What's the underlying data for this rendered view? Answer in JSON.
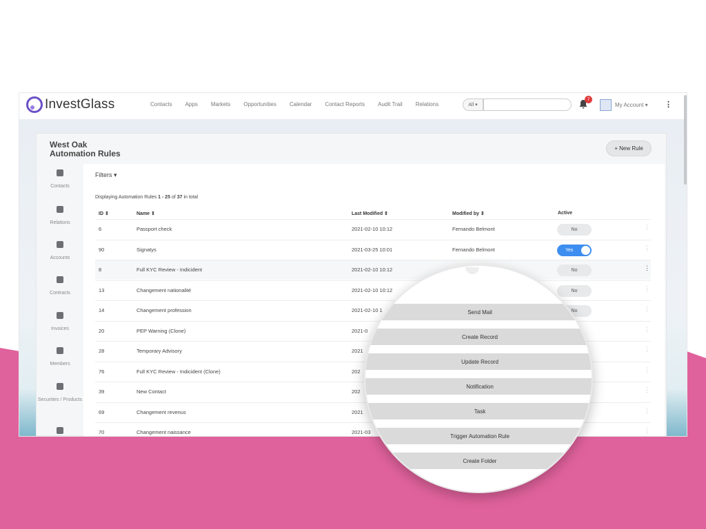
{
  "brand": {
    "name": "InvestGlass"
  },
  "nav": [
    "Contacts",
    "Apps",
    "Markets",
    "Opportunities",
    "Calendar",
    "Contact Reports",
    "Audit Trail",
    "Relations"
  ],
  "search": {
    "scope": "All ▾",
    "placeholder": ""
  },
  "notifications": {
    "count": "7"
  },
  "account": {
    "label": "My Account ▾"
  },
  "page": {
    "title_line1": "West Oak",
    "title_line2": "Automation Rules",
    "new_rule": "+ New Rule",
    "filters": "Filters ▾",
    "displaying_prefix": "Displaying Automation Rules ",
    "displaying_range": "1 - 25",
    "displaying_of": " of ",
    "displaying_total": "37",
    "displaying_suffix": " in total"
  },
  "sidebar": [
    {
      "label": "Contacts",
      "icon": "users-icon"
    },
    {
      "label": "Relations",
      "icon": "relations-icon"
    },
    {
      "label": "Accounts",
      "icon": "accounts-icon"
    },
    {
      "label": "Contracts",
      "icon": "contracts-icon"
    },
    {
      "label": "Invoices",
      "icon": "invoices-icon"
    },
    {
      "label": "Members",
      "icon": "members-icon"
    },
    {
      "label": "Securities / Products",
      "icon": "securities-icon"
    },
    {
      "label": "",
      "icon": "document-icon"
    }
  ],
  "table": {
    "headers": {
      "id": "ID ⇕",
      "name": "Name ⇕",
      "last_modified": "Last Modified ⇕",
      "modified_by": "Modified by ⇕",
      "active": "Active"
    },
    "rows": [
      {
        "id": "6",
        "name": "Passport check",
        "last_modified": "2021-02-10 10:12",
        "modified_by": "Fernando Belmont",
        "active": "No"
      },
      {
        "id": "90",
        "name": "Signatys",
        "last_modified": "2021-03-25 10:01",
        "modified_by": "Fernando Belmont",
        "active": "Yes"
      },
      {
        "id": "8",
        "name": "Full KYC Review - Indicident",
        "last_modified": "2021-02-10 10:12",
        "modified_by": "",
        "active": "No"
      },
      {
        "id": "13",
        "name": "Changement nationalité",
        "last_modified": "2021-02-10 10:12",
        "modified_by": "",
        "active": "No"
      },
      {
        "id": "14",
        "name": "Changement profession",
        "last_modified": "2021-02-10 1",
        "modified_by": "",
        "active": "No"
      },
      {
        "id": "20",
        "name": "PEP Warning (Clone)",
        "last_modified": "2021-0",
        "modified_by": "",
        "active": ""
      },
      {
        "id": "28",
        "name": "Temporary Advisory",
        "last_modified": "2021",
        "modified_by": "",
        "active": ""
      },
      {
        "id": "76",
        "name": "Full KYC Review - Indicident (Clone)",
        "last_modified": "202",
        "modified_by": "",
        "active": ""
      },
      {
        "id": "39",
        "name": "New Contact",
        "last_modified": "202",
        "modified_by": "",
        "active": ""
      },
      {
        "id": "69",
        "name": "Changement revenus",
        "last_modified": "2021",
        "modified_by": "",
        "active": ""
      },
      {
        "id": "70",
        "name": "Changement naissance",
        "last_modified": "2021-03",
        "modified_by": "",
        "active": ""
      }
    ]
  },
  "action_menu": [
    "Send Mail",
    "Create Record",
    "Update Record",
    "Notification",
    "Task",
    "Trigger Automation Rule",
    "Create Folder"
  ],
  "colors": {
    "accent_pink": "#e0629c",
    "toggle_on": "#3d8ef0",
    "brand_purple": "#6a4fc6"
  }
}
